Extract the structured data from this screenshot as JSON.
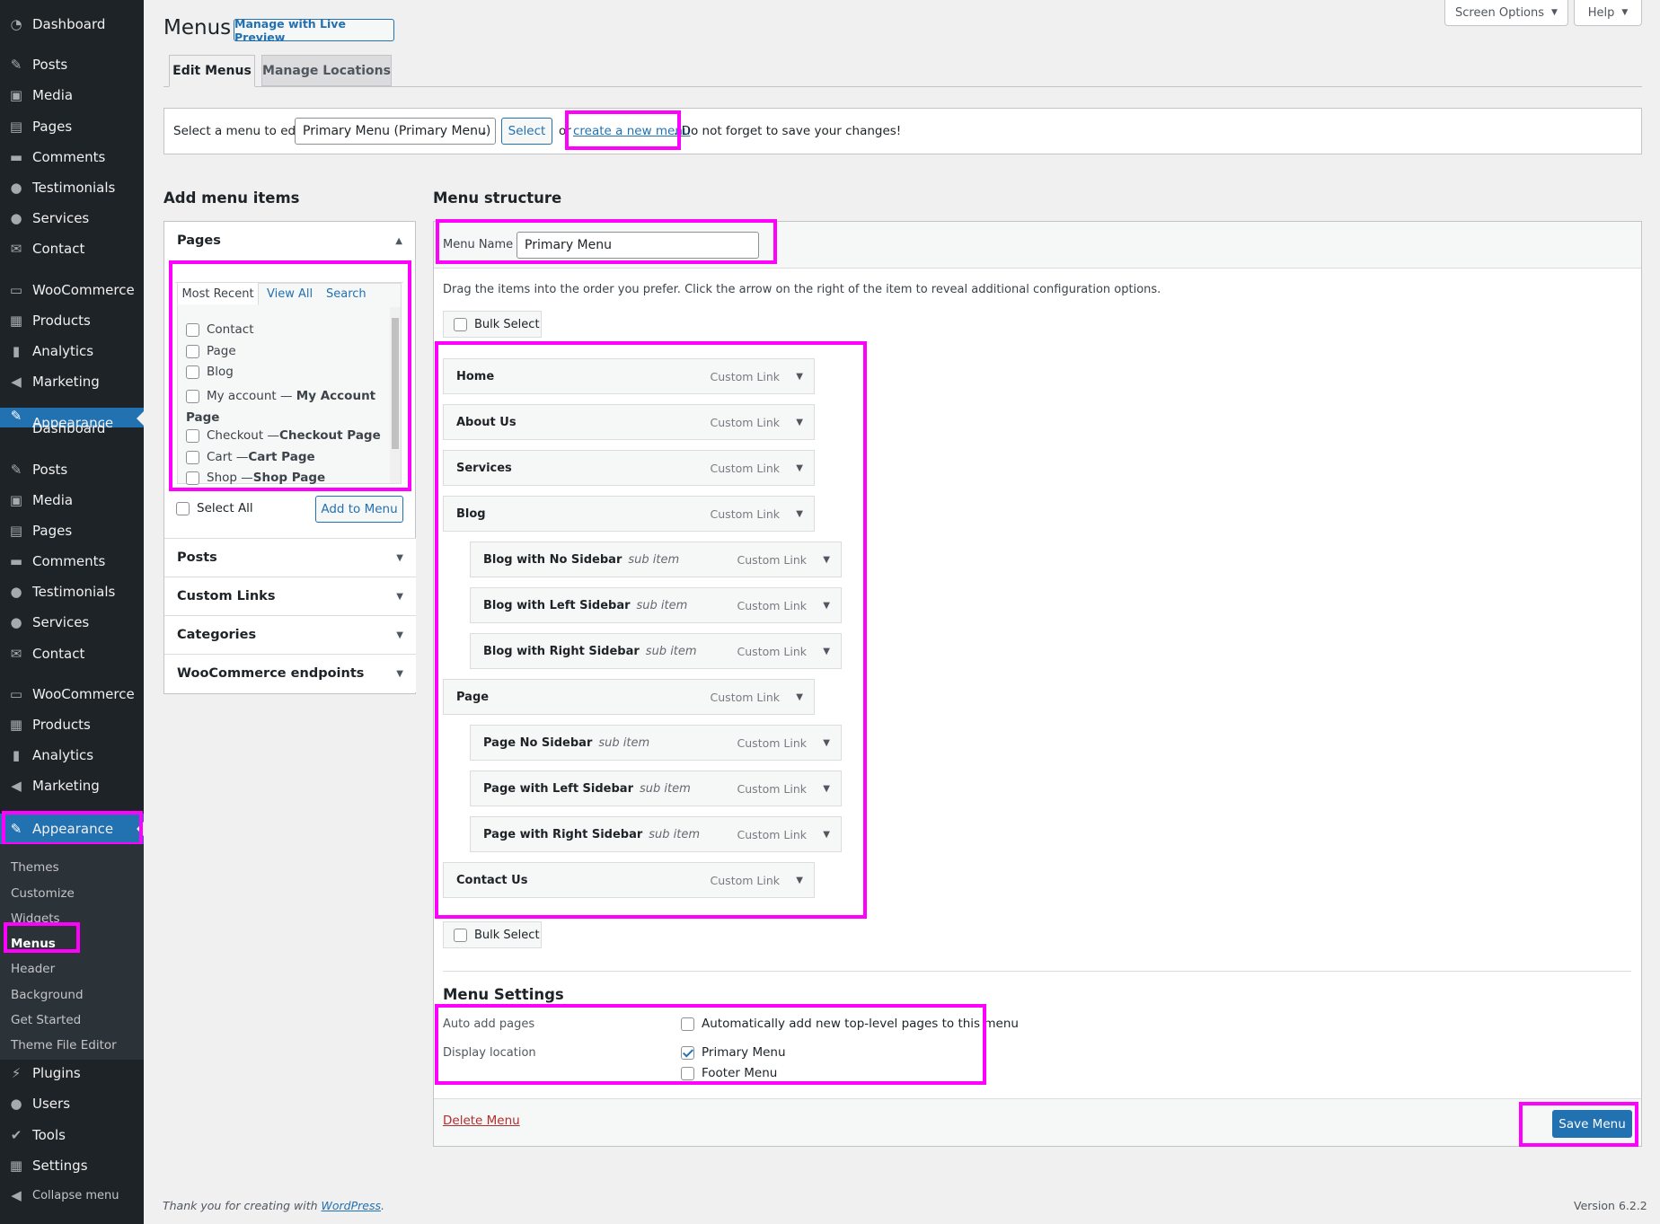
{
  "sidebar": {
    "menu_a": [
      {
        "label": "Dashboard",
        "icon": "dashboard-icon"
      },
      {
        "label": "Posts",
        "icon": "pin-icon"
      },
      {
        "label": "Media",
        "icon": "media-icon"
      },
      {
        "label": "Pages",
        "icon": "page-icon"
      },
      {
        "label": "Comments",
        "icon": "comment-icon"
      },
      {
        "label": "Testimonials",
        "icon": "user-icon"
      },
      {
        "label": "Services",
        "icon": "user-icon"
      },
      {
        "label": "Contact",
        "icon": "mail-icon"
      },
      {
        "label": "WooCommerce",
        "icon": "woo-icon"
      },
      {
        "label": "Products",
        "icon": "archive-icon"
      },
      {
        "label": "Analytics",
        "icon": "chart-icon"
      },
      {
        "label": "Marketing",
        "icon": "megaphone-icon"
      },
      {
        "label": "Appearance",
        "icon": "brush-icon"
      }
    ],
    "menu_b": [
      {
        "label": "Dashboard",
        "icon": "dashboard-icon"
      },
      {
        "label": "Posts",
        "icon": "pin-icon"
      },
      {
        "label": "Media",
        "icon": "media-icon"
      },
      {
        "label": "Pages",
        "icon": "page-icon"
      },
      {
        "label": "Comments",
        "icon": "comment-icon"
      },
      {
        "label": "Testimonials",
        "icon": "user-icon"
      },
      {
        "label": "Services",
        "icon": "user-icon"
      },
      {
        "label": "Contact",
        "icon": "mail-icon"
      },
      {
        "label": "WooCommerce",
        "icon": "woo-icon"
      },
      {
        "label": "Products",
        "icon": "archive-icon"
      },
      {
        "label": "Analytics",
        "icon": "chart-icon"
      },
      {
        "label": "Marketing",
        "icon": "megaphone-icon"
      },
      {
        "label": "Appearance",
        "icon": "brush-icon"
      }
    ],
    "submenu": [
      "Themes",
      "Customize",
      "Widgets",
      "Menus",
      "Header",
      "Background",
      "Get Started",
      "Theme File Editor"
    ],
    "bottom": [
      {
        "label": "Plugins",
        "icon": "plug-icon"
      },
      {
        "label": "Users",
        "icon": "user-icon"
      },
      {
        "label": "Tools",
        "icon": "wrench-icon"
      },
      {
        "label": "Settings",
        "icon": "settings-icon"
      },
      {
        "label": "Collapse menu",
        "icon": "collapse-icon"
      }
    ]
  },
  "header": {
    "title": "Menus",
    "live_preview": "Manage with Live Preview",
    "screen_options": "Screen Options",
    "help": "Help",
    "tab_edit": "Edit Menus",
    "tab_locations": "Manage Locations"
  },
  "select_bar": {
    "label": "Select a menu to edit:",
    "selected": "Primary Menu (Primary Menu)",
    "select_btn": "Select",
    "or": "or",
    "create_link": "create a new menu",
    "reminder": ". Do not forget to save your changes!"
  },
  "add_items": {
    "heading": "Add menu items",
    "pages_title": "Pages",
    "tabs": [
      "Most Recent",
      "View All",
      "Search"
    ],
    "pages": [
      {
        "label": "Contact",
        "suffix": ""
      },
      {
        "label": "Page",
        "suffix": ""
      },
      {
        "label": "Blog",
        "suffix": ""
      },
      {
        "label": "My account — ",
        "suffix": "My Account Page"
      },
      {
        "label": "Checkout — ",
        "suffix": "Checkout Page"
      },
      {
        "label": "Cart — ",
        "suffix": "Cart Page"
      },
      {
        "label": "Shop — ",
        "suffix": "Shop Page"
      }
    ],
    "select_all": "Select All",
    "add_to_menu": "Add to Menu",
    "sections": [
      "Posts",
      "Custom Links",
      "Categories",
      "WooCommerce endpoints"
    ]
  },
  "structure": {
    "heading": "Menu structure",
    "menu_name_label": "Menu Name",
    "menu_name_value": "Primary Menu",
    "instructions": "Drag the items into the order you prefer. Click the arrow on the right of the item to reveal additional configuration options.",
    "bulk_select": "Bulk Select",
    "items": [
      {
        "title": "Home",
        "sub": "",
        "type": "Custom Link"
      },
      {
        "title": "About Us",
        "sub": "",
        "type": "Custom Link"
      },
      {
        "title": "Services",
        "sub": "",
        "type": "Custom Link"
      },
      {
        "title": "Blog",
        "sub": "",
        "type": "Custom Link"
      },
      {
        "title": "Blog with No Sidebar",
        "sub": "sub item",
        "type": "Custom Link"
      },
      {
        "title": "Blog with Left Sidebar",
        "sub": "sub item",
        "type": "Custom Link"
      },
      {
        "title": "Blog with Right Sidebar",
        "sub": "sub item",
        "type": "Custom Link"
      },
      {
        "title": "Page",
        "sub": "",
        "type": "Custom Link"
      },
      {
        "title": "Page No Sidebar",
        "sub": "sub item",
        "type": "Custom Link"
      },
      {
        "title": "Page with Left Sidebar",
        "sub": "sub item",
        "type": "Custom Link"
      },
      {
        "title": "Page with Right Sidebar",
        "sub": "sub item",
        "type": "Custom Link"
      },
      {
        "title": "Contact Us",
        "sub": "",
        "type": "Custom Link"
      }
    ],
    "settings_heading": "Menu Settings",
    "auto_add_label": "Auto add pages",
    "auto_add_option": "Automatically add new top-level pages to this menu",
    "display_location_label": "Display location",
    "locations": [
      {
        "label": "Primary Menu",
        "checked": true
      },
      {
        "label": "Footer Menu",
        "checked": false
      }
    ],
    "delete": "Delete Menu",
    "save": "Save Menu"
  },
  "footer": {
    "thanks": "Thank you for creating with ",
    "wp": "WordPress",
    "period": ".",
    "version": "Version 6.2.2"
  },
  "colors": {
    "accent": "#2271b1",
    "highlight": "#ff00ff",
    "sidebar": "#1d2327"
  }
}
